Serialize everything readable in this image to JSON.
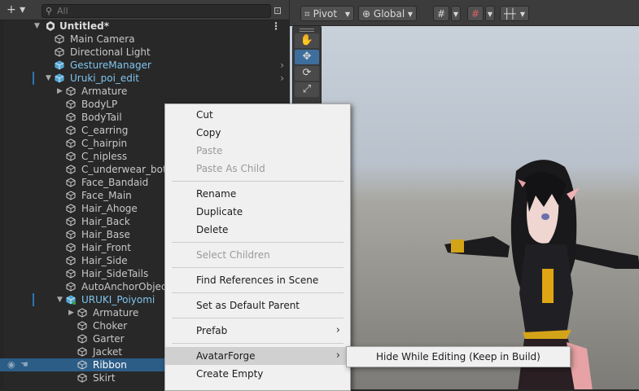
{
  "hierarchy": {
    "add_label": "+ ▾",
    "search_placeholder": "All",
    "scene_title": "Untitled*",
    "rows": [
      {
        "label": "Main Camera",
        "icon": "gameobject-cube-icon"
      },
      {
        "label": "Directional Light",
        "icon": "gameobject-cube-icon"
      },
      {
        "label": "GestureManager",
        "icon": "prefab-cube-icon"
      },
      {
        "label": "Uruki_poi_edit",
        "icon": "prefab-cube-icon"
      },
      {
        "label": "Armature",
        "icon": "gameobject-cube-icon"
      },
      {
        "label": "BodyLP",
        "icon": "gameobject-cube-icon"
      },
      {
        "label": "BodyTail",
        "icon": "gameobject-cube-icon"
      },
      {
        "label": "C_earring",
        "icon": "gameobject-cube-icon"
      },
      {
        "label": "C_hairpin",
        "icon": "gameobject-cube-icon"
      },
      {
        "label": "C_nipless",
        "icon": "gameobject-cube-icon"
      },
      {
        "label": "C_underwear_bottom",
        "icon": "gameobject-cube-icon"
      },
      {
        "label": "Face_Bandaid",
        "icon": "gameobject-cube-icon"
      },
      {
        "label": "Face_Main",
        "icon": "gameobject-cube-icon"
      },
      {
        "label": "Hair_Ahoge",
        "icon": "gameobject-cube-icon"
      },
      {
        "label": "Hair_Back",
        "icon": "gameobject-cube-icon"
      },
      {
        "label": "Hair_Base",
        "icon": "gameobject-cube-icon"
      },
      {
        "label": "Hair_Front",
        "icon": "gameobject-cube-icon"
      },
      {
        "label": "Hair_Side",
        "icon": "gameobject-cube-icon"
      },
      {
        "label": "Hair_SideTails",
        "icon": "gameobject-cube-icon"
      },
      {
        "label": "AutoAnchorObject",
        "icon": "gameobject-cube-icon"
      },
      {
        "label": "URUKI_Poiyomi",
        "icon": "prefab-variant-icon"
      },
      {
        "label": "Armature",
        "icon": "gameobject-cube-icon"
      },
      {
        "label": "Choker",
        "icon": "gameobject-cube-icon"
      },
      {
        "label": "Garter",
        "icon": "gameobject-cube-icon"
      },
      {
        "label": "Jacket",
        "icon": "gameobject-cube-icon"
      },
      {
        "label": "Ribbon",
        "icon": "gameobject-cube-icon"
      },
      {
        "label": "Skirt",
        "icon": "gameobject-cube-icon"
      }
    ]
  },
  "scene_toolbar": {
    "pivot_label": "Pivot",
    "global_label": "Global"
  },
  "context_menu": {
    "items": [
      {
        "label": "Cut",
        "enabled": true
      },
      {
        "label": "Copy",
        "enabled": true
      },
      {
        "label": "Paste",
        "enabled": false
      },
      {
        "label": "Paste As Child",
        "enabled": false
      },
      {
        "label": "Rename",
        "enabled": true
      },
      {
        "label": "Duplicate",
        "enabled": true
      },
      {
        "label": "Delete",
        "enabled": true
      },
      {
        "label": "Select Children",
        "enabled": false
      },
      {
        "label": "Find References in Scene",
        "enabled": true
      },
      {
        "label": "Set as Default Parent",
        "enabled": true
      },
      {
        "label": "Prefab",
        "enabled": true
      },
      {
        "label": "AvatarForge",
        "enabled": true
      },
      {
        "label": "Create Empty",
        "enabled": true
      }
    ],
    "submenu_arrow": "›"
  },
  "submenu": {
    "items": [
      {
        "label": "Hide While Editing (Keep in Build)"
      }
    ]
  },
  "colors": {
    "panel_bg": "#282828",
    "selection": "#2c5d87",
    "menu_bg": "#f0f0f0",
    "prefab_blue": "#58b6e8"
  }
}
